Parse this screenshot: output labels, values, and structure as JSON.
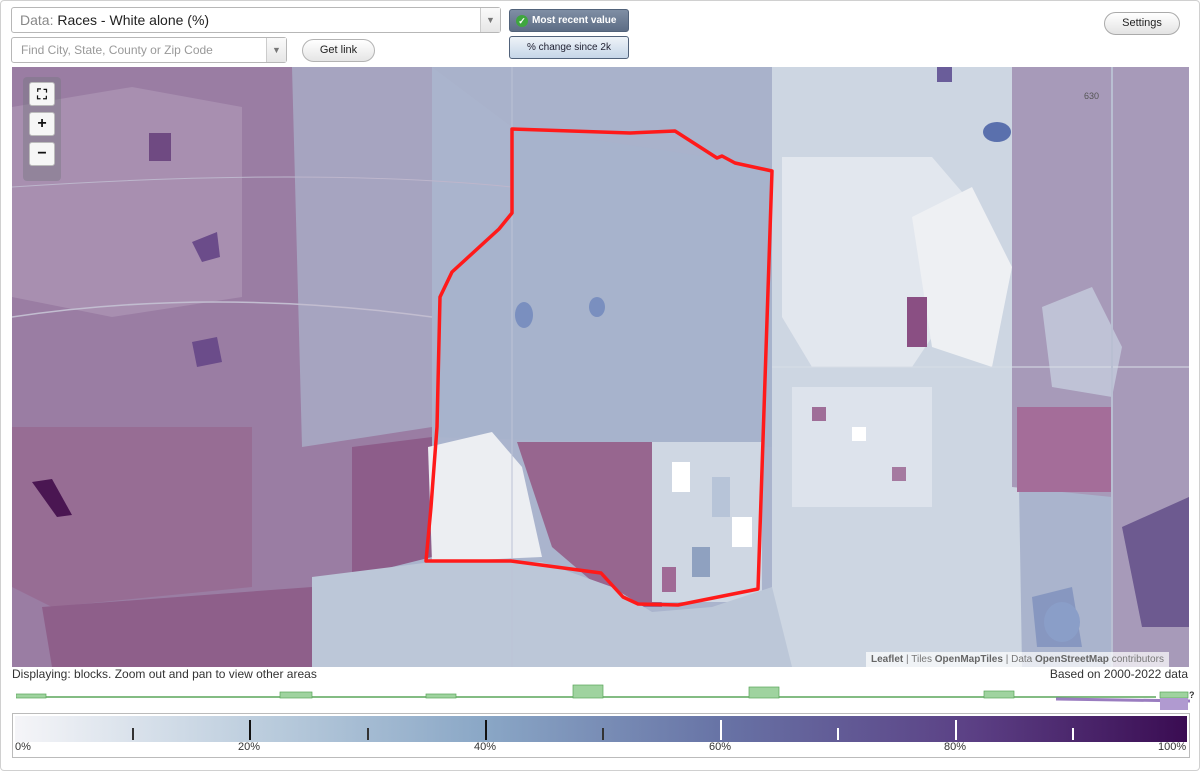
{
  "controls": {
    "data_prefix": "Data:",
    "data_value": "Races - White alone (%)",
    "search_placeholder": "Find City, State, County or Zip Code",
    "get_link": "Get link",
    "most_recent": "Most recent value",
    "pct_change": "% change since 2k",
    "settings": "Settings"
  },
  "map": {
    "road_label": "630",
    "attribution": {
      "leaflet": "Leaflet",
      "tiles_label": "Tiles",
      "tiles": "OpenMapTiles",
      "data_label": "Data",
      "data": "OpenStreetMap",
      "contributors": "contributors"
    },
    "colors": {
      "highlight_outline": "#ff1a1a",
      "low": "#eeeff3",
      "mid": "#a9b8cf",
      "high": "#8b5f8e",
      "max": "#4a1652"
    }
  },
  "status": {
    "displaying": "Displaying: blocks. Zoom out and pan to view other areas",
    "based_on": "Based on 2000-2022 data"
  },
  "legend": {
    "labels": [
      "0%",
      "20%",
      "40%",
      "60%",
      "80%",
      "100%"
    ],
    "unknown_marker": "?"
  }
}
